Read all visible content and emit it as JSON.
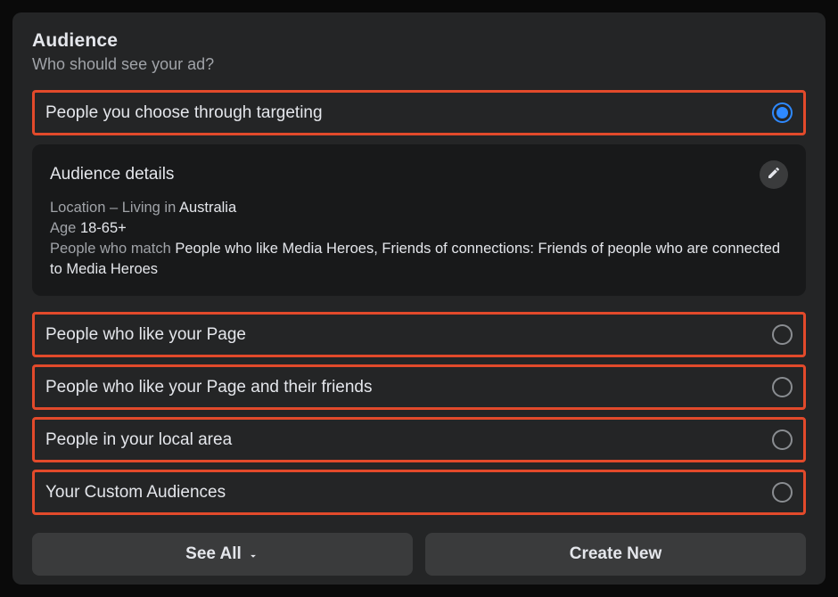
{
  "header": {
    "title": "Audience",
    "subtitle": "Who should see your ad?"
  },
  "options": [
    {
      "label": "People you choose through targeting",
      "selected": true
    },
    {
      "label": "People who like your Page",
      "selected": false
    },
    {
      "label": "People who like your Page and their friends",
      "selected": false
    },
    {
      "label": "People in your local area",
      "selected": false
    },
    {
      "label": "Your Custom Audiences",
      "selected": false
    }
  ],
  "details": {
    "title": "Audience details",
    "location_prefix": "Location – Living in ",
    "location_value": "Australia",
    "age_prefix": "Age ",
    "age_value": "18-65+",
    "match_prefix": "People who match ",
    "match_value": "People who like Media Heroes, Friends of connections: Friends of people who are connected to Media Heroes"
  },
  "buttons": {
    "see_all": "See All",
    "create_new": "Create New"
  }
}
